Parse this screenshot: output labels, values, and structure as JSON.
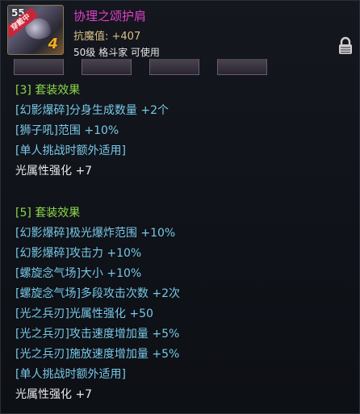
{
  "item": {
    "level": "55",
    "equipped_tag": "穿戴中",
    "enhance": "4",
    "name": "协理之颂护肩",
    "stat": "抗魔值: +407",
    "requirement": "50级 格斗家 可使用"
  },
  "colors": {
    "name": "#e040c8",
    "set_header": "#8cd848",
    "effect": "#78c8e8",
    "plain": "#e8e8e8",
    "stat": "#d8c088"
  },
  "icons": [
    "lock-icon"
  ],
  "set3": {
    "header": "[3] 套装效果",
    "lines": [
      "[幻影爆碎]分身生成数量 +2个",
      "[狮子吼]范围 +10%",
      "[单人挑战时额外适用]",
      "光属性强化 +7"
    ]
  },
  "set5": {
    "header": "[5] 套装效果",
    "lines": [
      "[幻影爆碎]极光爆炸范围 +10%",
      "[幻影爆碎]攻击力 +10%",
      "[螺旋念气场]大小 +10%",
      "[螺旋念气场]多段攻击次数 +2次",
      "[光之兵刃]光属性强化 +50",
      "[光之兵刃]攻击速度增加量 +5%",
      "[光之兵刃]施放速度增加量 +5%",
      "[单人挑战时额外适用]",
      "光属性强化 +7"
    ]
  }
}
